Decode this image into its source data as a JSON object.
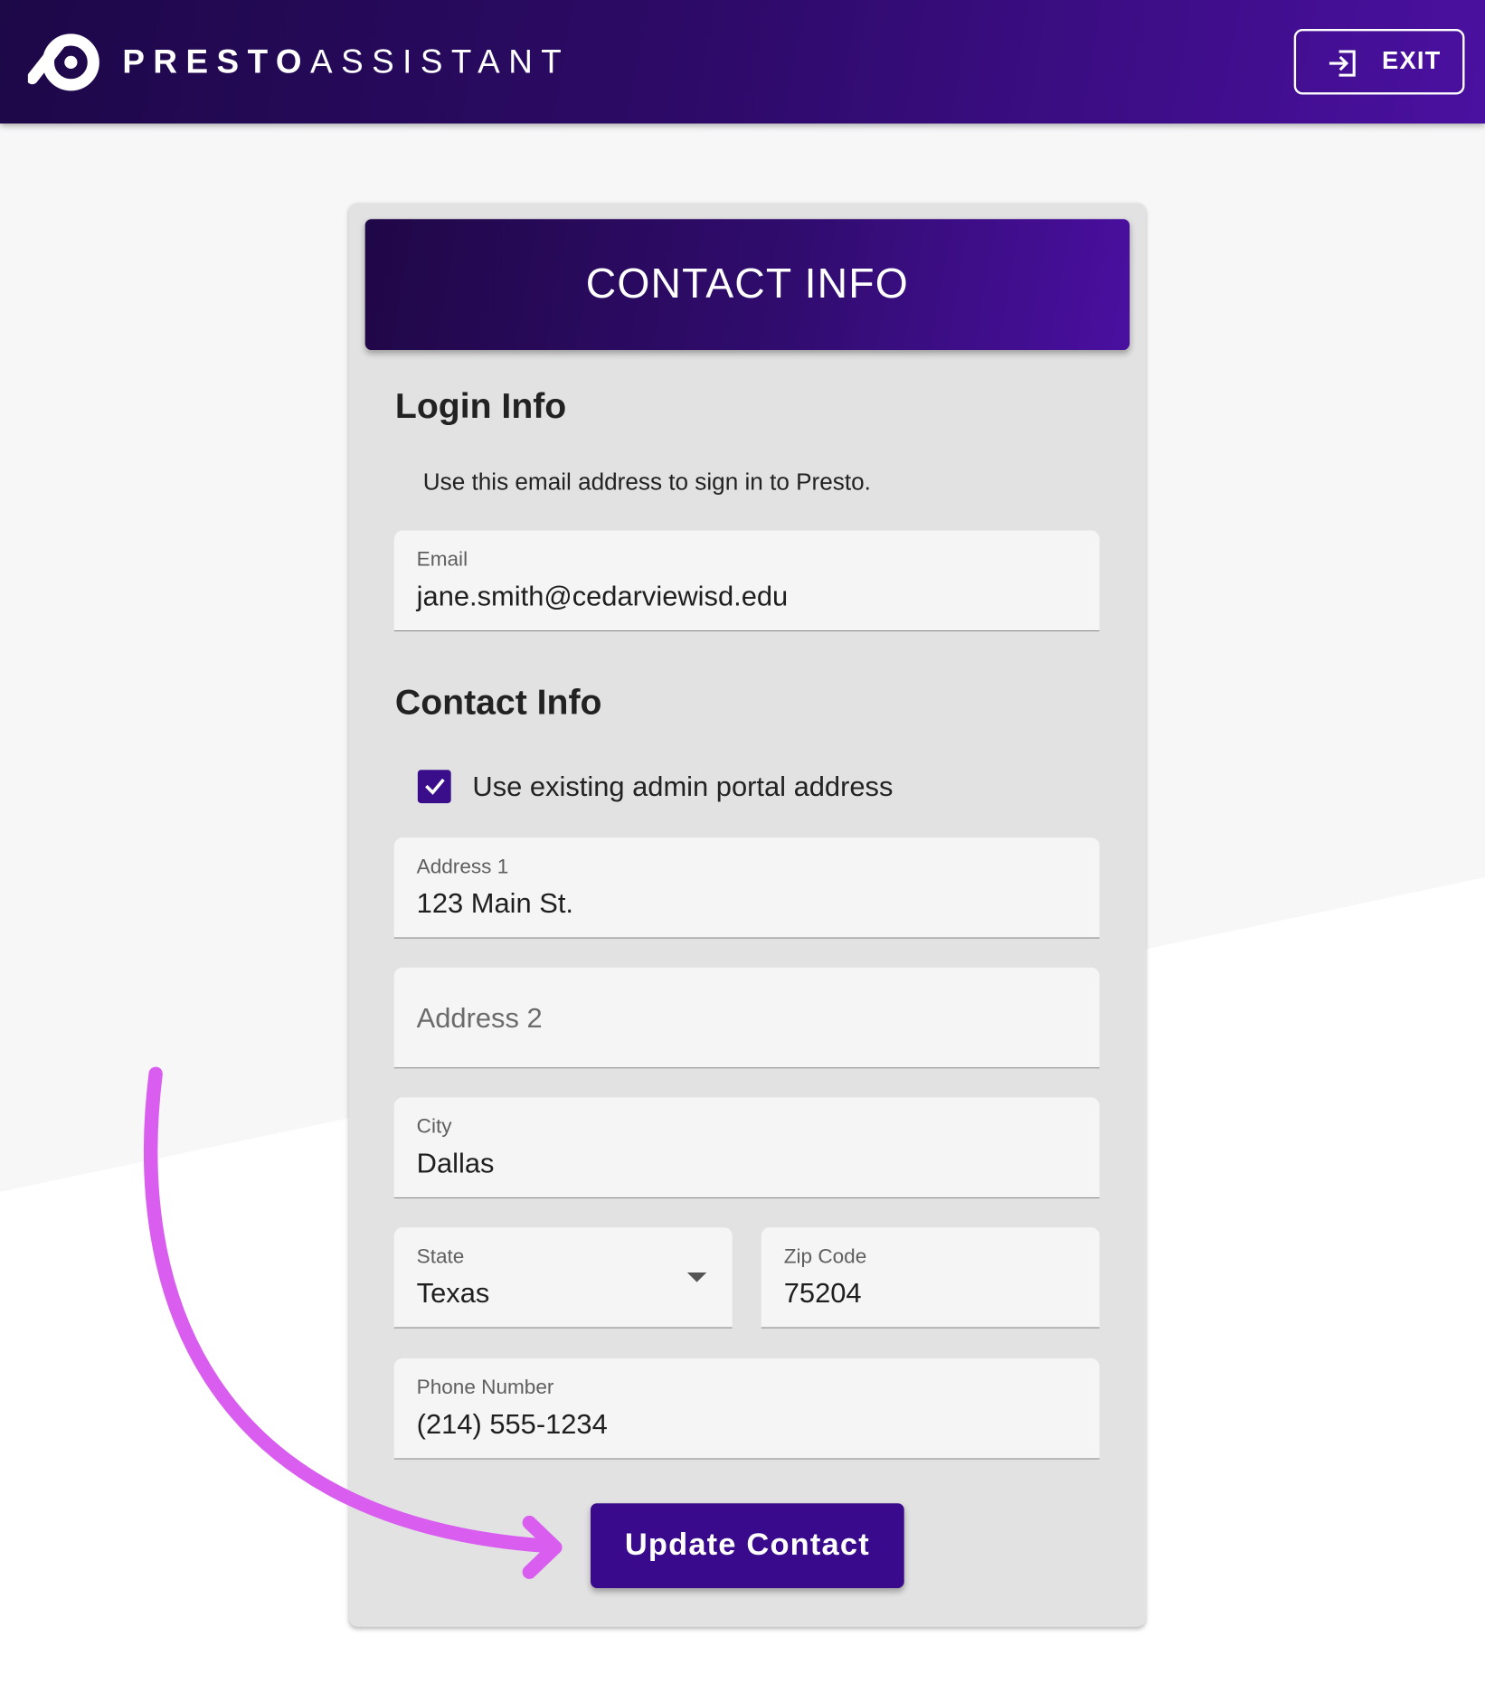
{
  "header": {
    "brand_bold": "PRESTO",
    "brand_light": "ASSISTANT",
    "exit_label": "EXIT"
  },
  "card": {
    "title": "CONTACT INFO",
    "login_section": {
      "title": "Login Info",
      "helper": "Use this email address to sign in to Presto.",
      "email_label": "Email",
      "email_value": "jane.smith@cedarviewisd.edu"
    },
    "contact_section": {
      "title": "Contact Info",
      "use_existing_label": "Use existing admin portal address",
      "use_existing_checked": true,
      "address1_label": "Address 1",
      "address1_value": "123 Main St.",
      "address2_placeholder": "Address 2",
      "city_label": "City",
      "city_value": "Dallas",
      "state_label": "State",
      "state_value": "Texas",
      "zip_label": "Zip Code",
      "zip_value": "75204",
      "phone_label": "Phone Number",
      "phone_value": "(214) 555-1234"
    },
    "update_button": "Update Contact"
  },
  "colors": {
    "header_dark": "#1d0848",
    "header_light": "#4a10a0",
    "primary_button": "#3a0a8c",
    "annotation_arrow": "#d95ef0",
    "card_bg": "#e2e2e3",
    "field_bg": "#f5f5f6"
  },
  "icons": {
    "logo": "presto-logo-icon",
    "exit": "exit-icon",
    "checkbox": "checkmark-icon",
    "state_dropdown": "chevron-down-icon",
    "annotation": "curved-arrow-icon"
  }
}
